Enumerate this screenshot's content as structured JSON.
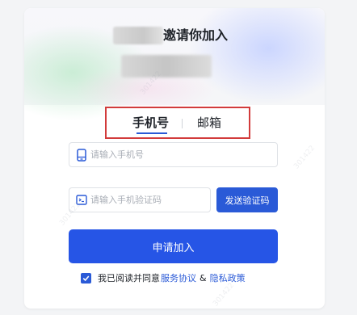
{
  "invite": {
    "title": "邀请你加入"
  },
  "tabs": [
    {
      "label": "手机号",
      "active": true
    },
    {
      "label": "邮箱",
      "active": false
    }
  ],
  "form": {
    "phone_placeholder": "请输入手机号",
    "phone_icon": "phone-icon",
    "code_placeholder": "请输入手机验证码",
    "code_icon": "message-code-icon",
    "send_code_label": "发送验证码",
    "submit_label": "申请加入"
  },
  "agreement": {
    "checked": true,
    "prefix": "我已阅读并同意",
    "terms_label": "服务协议",
    "amp": "&",
    "privacy_label": "隐私政策"
  },
  "watermark_text": "301422",
  "colors": {
    "accent": "#2a5ad7",
    "submit": "#2655e6",
    "highlight_border": "#d23b3b"
  }
}
